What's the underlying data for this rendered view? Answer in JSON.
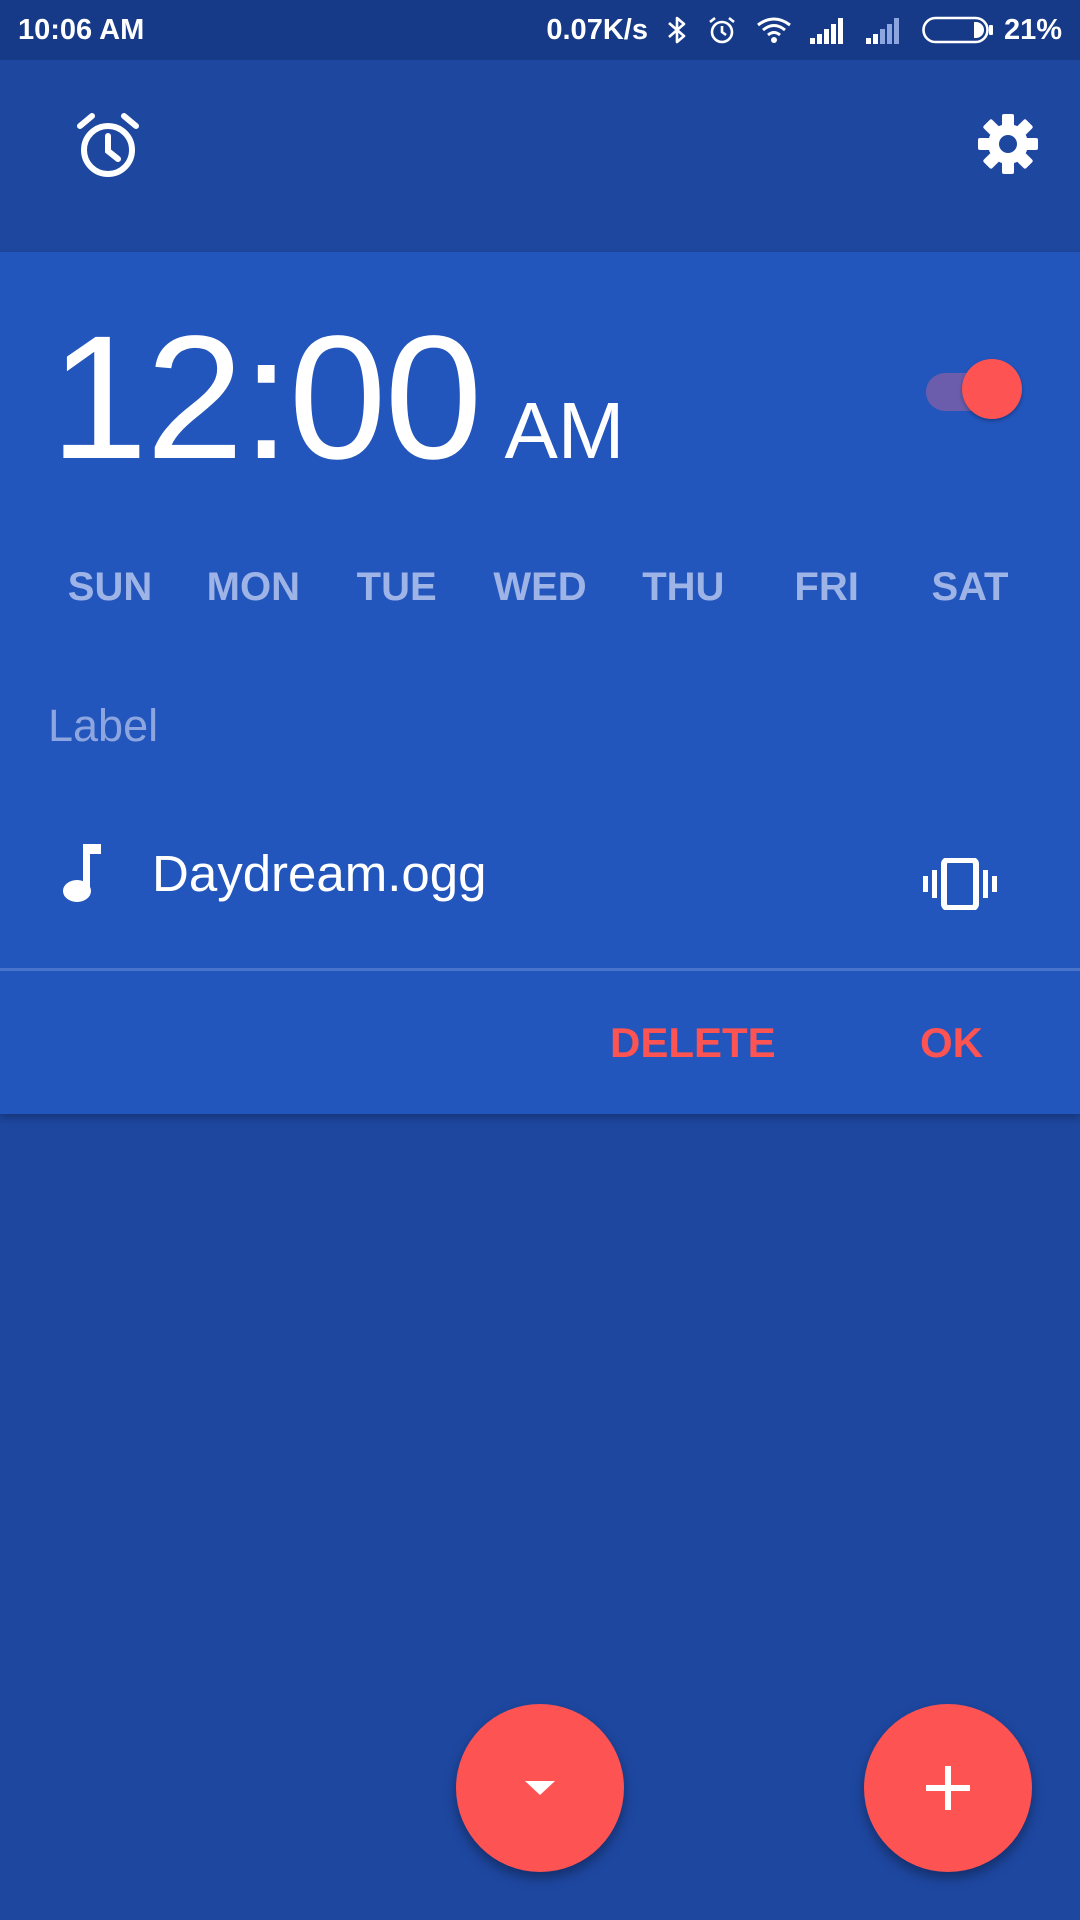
{
  "status_bar": {
    "time": "10:06 AM",
    "net_speed": "0.07K/s",
    "battery_percent": "21%",
    "battery_level": 0.21,
    "icons": [
      "bluetooth-icon",
      "alarm-status-icon",
      "wifi-icon",
      "signal-icon",
      "signal-icon-2",
      "battery-icon"
    ]
  },
  "app_bar": {
    "alarm_tab_icon": "alarm-icon",
    "settings_icon": "gear-icon"
  },
  "alarm": {
    "time": "12:00",
    "ampm": "AM",
    "enabled": true,
    "days": [
      "SUN",
      "MON",
      "TUE",
      "WED",
      "THU",
      "FRI",
      "SAT"
    ],
    "label_placeholder": "Label",
    "ringtone": "Daydream.ogg",
    "ringtone_icon": "music-note-icon",
    "vibrate_icon": "vibrate-icon",
    "delete_label": "DELETE",
    "ok_label": "OK"
  },
  "fabs": {
    "collapse_icon": "caret-down-icon",
    "add_icon": "plus-icon"
  },
  "colors": {
    "background": "#1e47a0",
    "card": "#2356bd",
    "status_bar": "#173a88",
    "accent": "#fd5352",
    "day_text": "#9fb4e6"
  }
}
